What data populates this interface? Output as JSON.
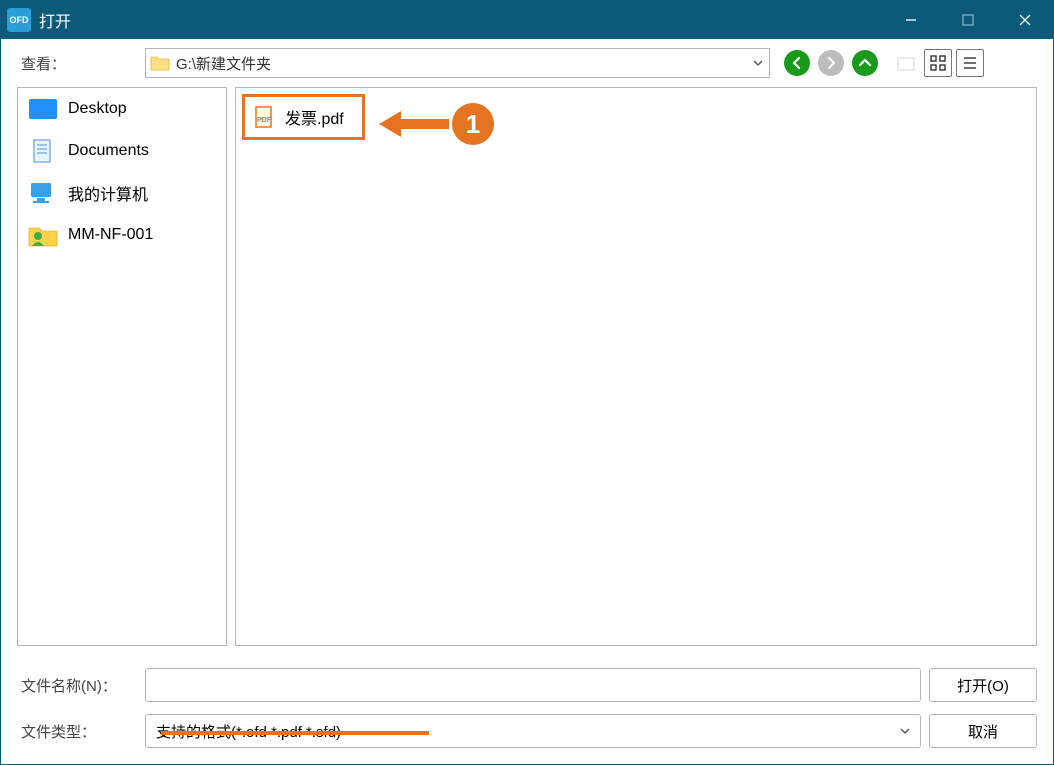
{
  "window": {
    "title": "打开",
    "app_icon_text": "OFD"
  },
  "toolbar": {
    "look_in_label": "查看：",
    "path_text": "G:\\新建文件夹"
  },
  "sidebar": {
    "items": [
      {
        "label": "Desktop"
      },
      {
        "label": "Documents"
      },
      {
        "label": "我的计算机"
      },
      {
        "label": "MM-NF-001"
      }
    ]
  },
  "content": {
    "files": [
      {
        "label": "发票.pdf"
      }
    ]
  },
  "bottom": {
    "filename_label": "文件名称(N)：",
    "filename_value": "",
    "filetype_label": "文件类型：",
    "filetype_value": "支持的格式(*.ofd *.pdf *.sfd)",
    "open_btn": "打开(O)",
    "cancel_btn": "取消"
  },
  "callout": {
    "number": "1"
  }
}
